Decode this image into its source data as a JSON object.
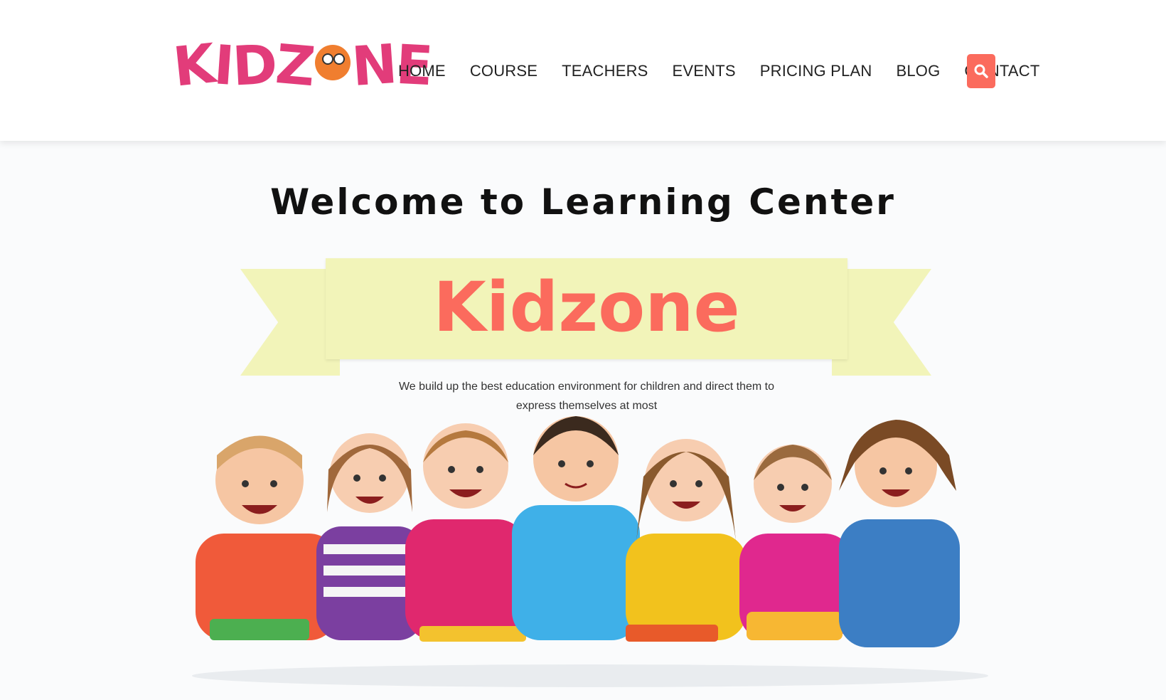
{
  "header": {
    "logo_text": "KIDZONE",
    "nav": [
      "HOME",
      "COURSE",
      "TEACHERS",
      "EVENTS",
      "PRICING PLAN",
      "BLOG",
      "CONTACT"
    ],
    "search_icon": "search-icon"
  },
  "hero": {
    "title": "Welcome to Learning Center",
    "banner": "Kidzone",
    "tagline": "We build up the best education environment for children and direct them to express themselves at most",
    "image": "children-lying-with-books"
  },
  "colors": {
    "brand_pink": "#e23c7a",
    "brand_orange": "#f07e2f",
    "accent_coral": "#fb6b5d",
    "banner_yellow": "#f2f4b9"
  }
}
